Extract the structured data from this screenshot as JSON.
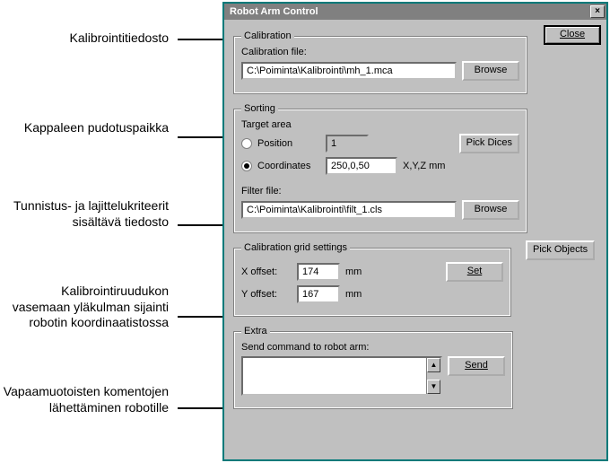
{
  "callouts": {
    "calib_file": "Kalibrointitiedosto",
    "target_area": "Kappaleen pudotuspaikka",
    "filter_file": "Tunnistus- ja lajittelukriteerit sisältävä tiedosto",
    "grid": "Kalibrointiruudukon vasemaan yläkulman sijainti robotin koordinaatistossa",
    "extra": "Vapaamuotoisten komentojen lähettäminen robotille"
  },
  "dialog": {
    "title": "Robot Arm Control",
    "close_button": "Close",
    "calibration": {
      "legend": "Calibration",
      "file_label": "Calibration file:",
      "file_value": "C:\\Poiminta\\Kalibrointi\\mh_1.mca",
      "browse": "Browse"
    },
    "sorting": {
      "legend": "Sorting",
      "target_area_label": "Target area",
      "position_label": "Position",
      "position_value": "1",
      "coordinates_label": "Coordinates",
      "coordinates_value": "250,0,50",
      "coord_unit": "X,Y,Z mm",
      "pick_dices": "Pick Dices",
      "filter_label": "Filter file:",
      "filter_value": "C:\\Poiminta\\Kalibrointi\\filt_1.cls",
      "browse": "Browse"
    },
    "pick_objects": "Pick Objects",
    "grid": {
      "legend": "Calibration grid settings",
      "x_label": "X offset:",
      "x_value": "174",
      "y_label": "Y offset:",
      "y_value": "167",
      "unit": "mm",
      "set": "Set"
    },
    "extra": {
      "legend": "Extra",
      "send_label": "Send command to robot arm:",
      "send": "Send"
    }
  }
}
